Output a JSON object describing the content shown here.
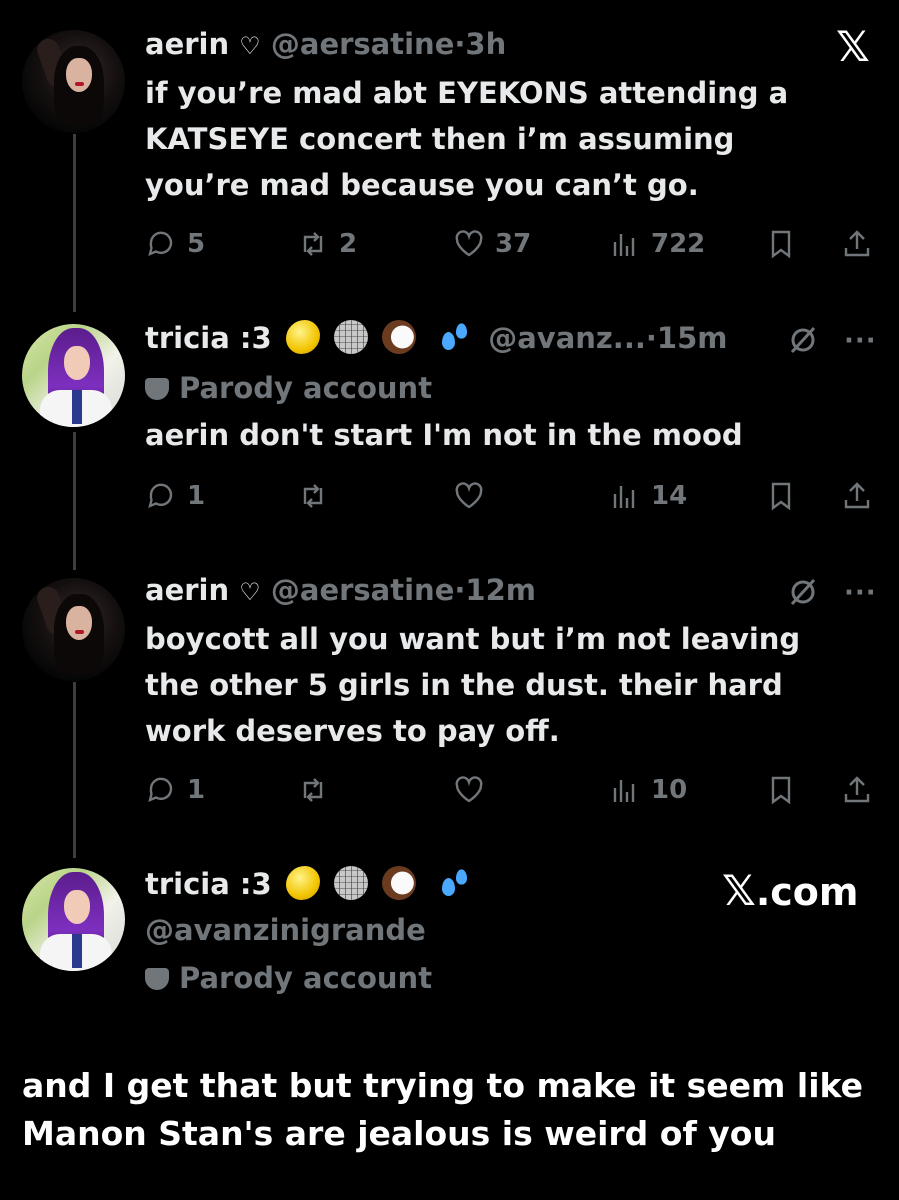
{
  "header": {
    "close_label": "𝕏"
  },
  "tweets": [
    {
      "name": "aerin",
      "handle": "@aersatine",
      "dot": "·",
      "time": "3h",
      "text": "if you’re mad abt EYEKONS attending a\nKATSEYE concert then i’m assuming\nyou’re mad because you can’t go.",
      "replies": "5",
      "retweets": "2",
      "likes": "37",
      "views": "722"
    },
    {
      "name": "tricia :3",
      "handle": "@avanz...",
      "dot": "·",
      "time": "15m",
      "parody": "Parody account",
      "text": "aerin don't start I'm not in the mood",
      "replies": "1",
      "retweets": "",
      "likes": "",
      "views": "14",
      "more": "···"
    },
    {
      "name": "aerin",
      "handle": "@aersatine",
      "dot": "·",
      "time": "12m",
      "text": "boycott all you want but i’m not leaving\nthe other 5 girls in the dust. their hard\nwork deserves to pay off.",
      "replies": "1",
      "retweets": "",
      "likes": "",
      "views": "10",
      "more": "···"
    },
    {
      "name": "tricia :3",
      "handle": "@avanzinigrande",
      "parody": "Parody account"
    }
  ],
  "watermark": {
    "mark": "𝕏",
    "text": ".com"
  },
  "caption": "and I get that but trying to make it seem like\nManon Stan's are jealous is weird of you",
  "icons": {
    "verified": "heart-outline-icon",
    "parody": "mask-icon",
    "grok": "grok-icon"
  }
}
